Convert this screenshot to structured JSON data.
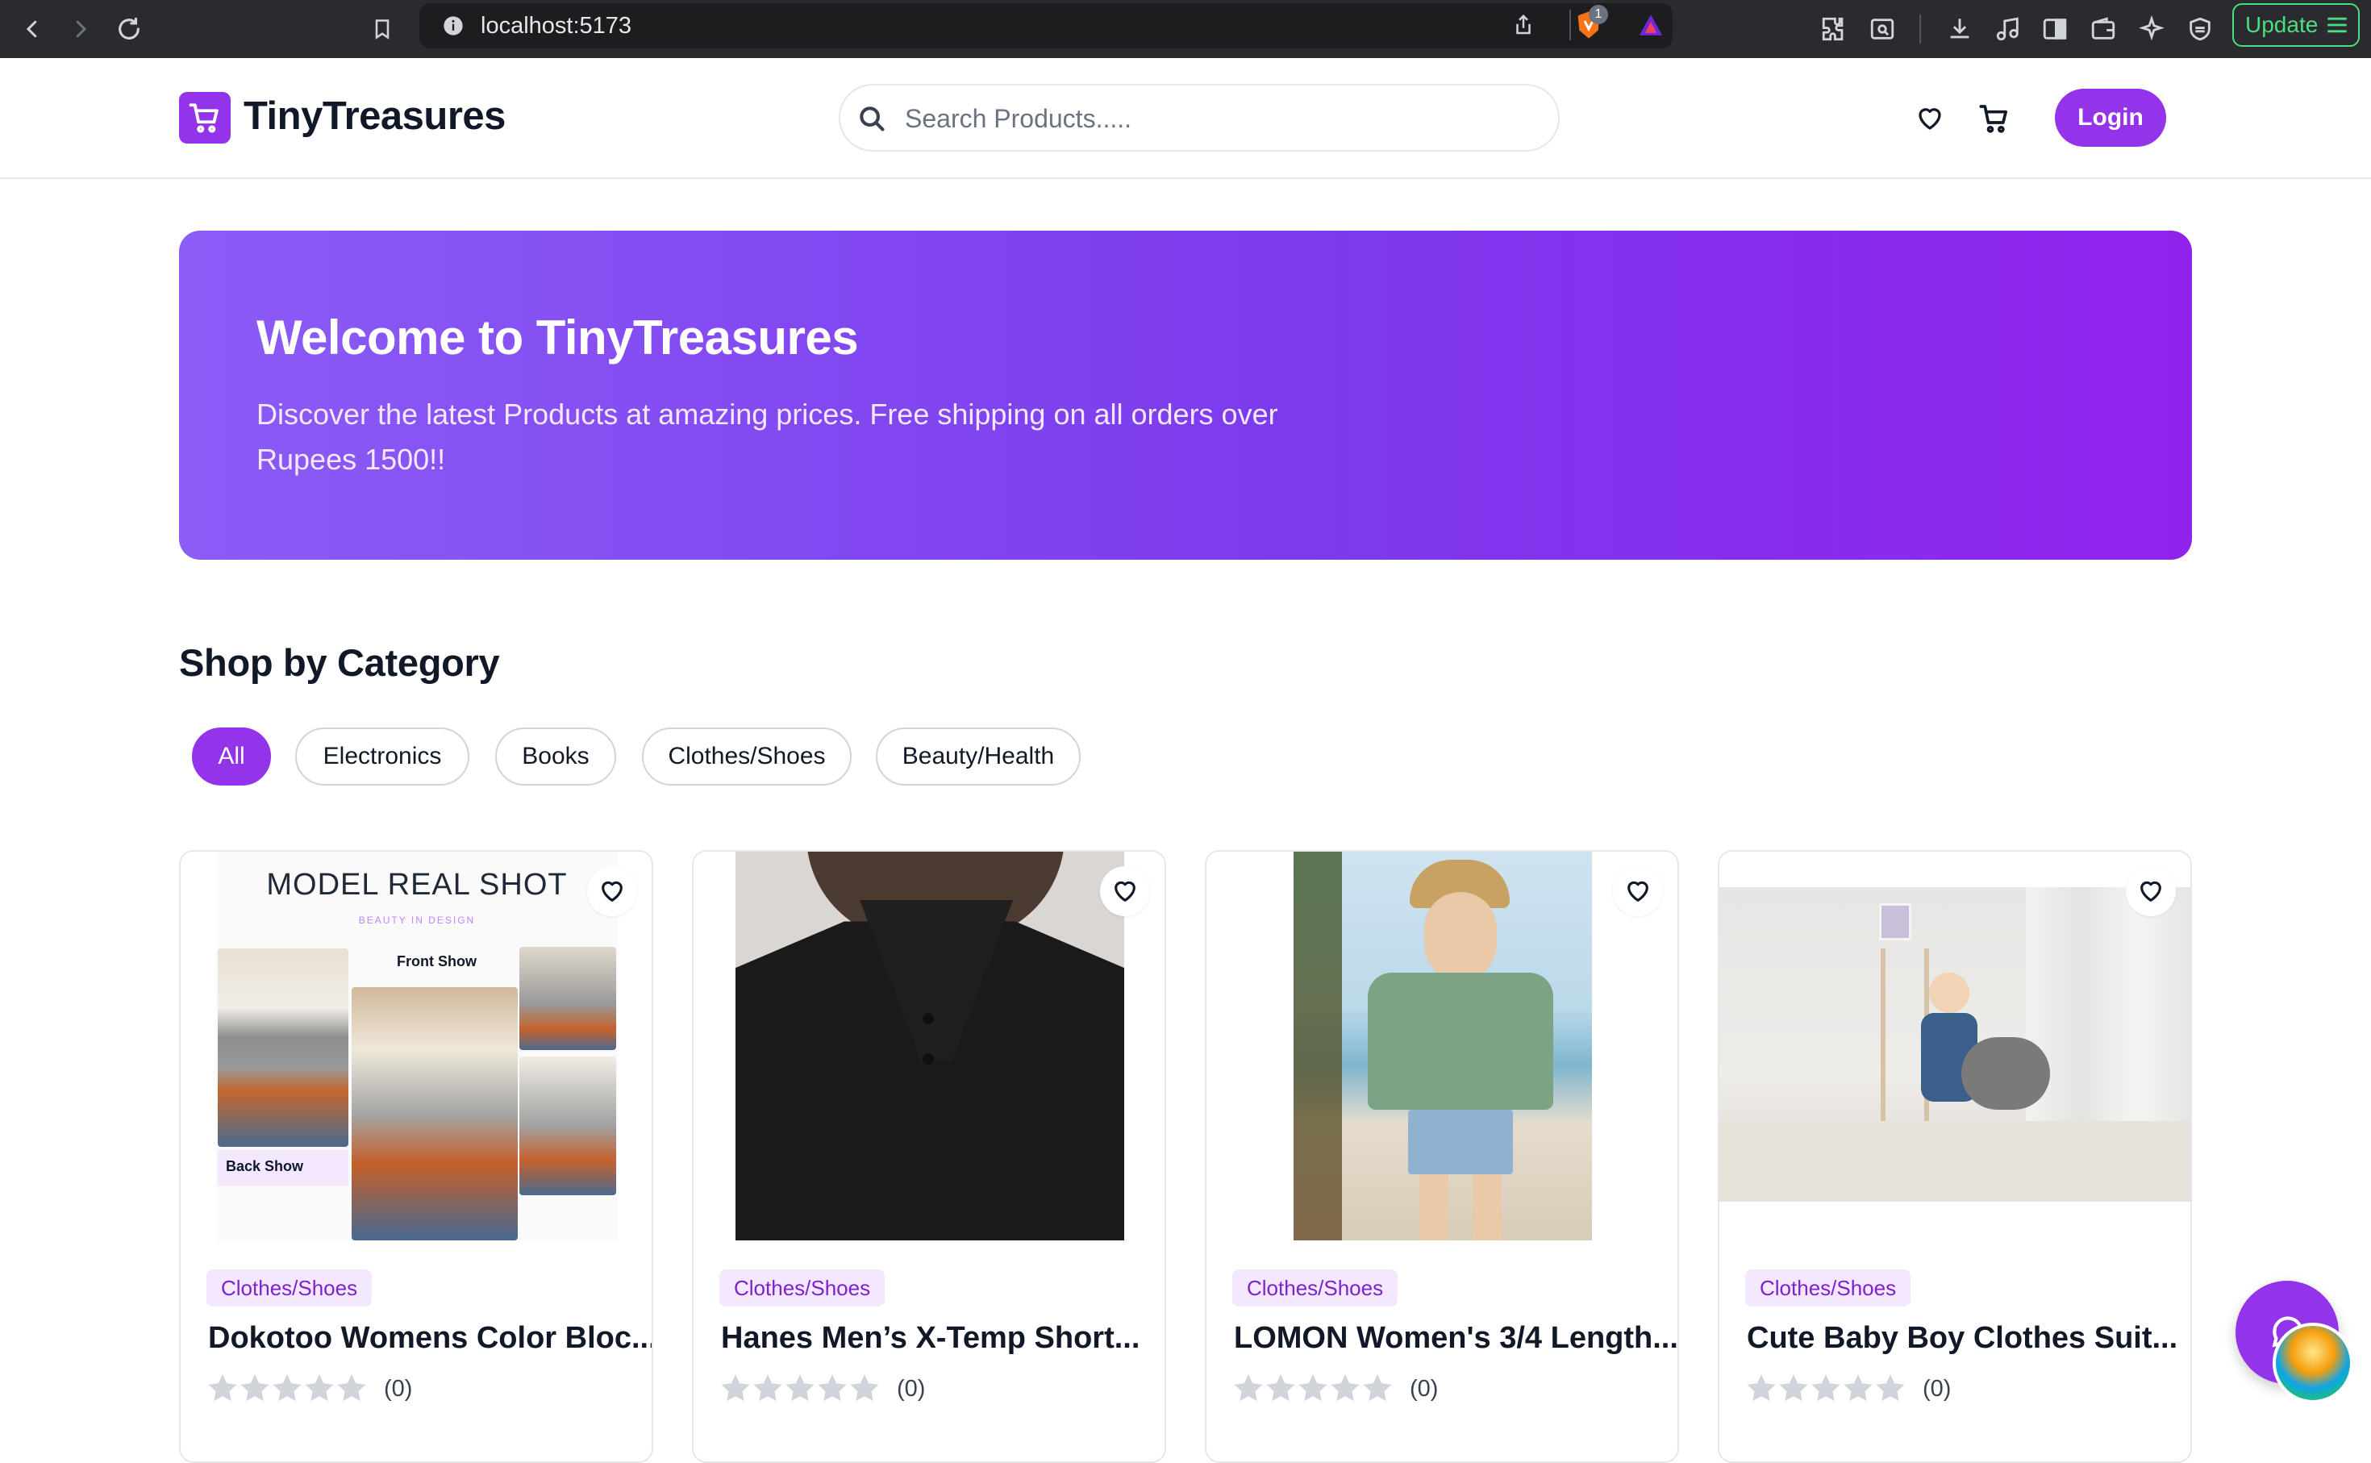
{
  "browser": {
    "url": "localhost:5173",
    "update_label": "Update",
    "brave_badge": "1"
  },
  "header": {
    "logo_text": "TinyTreasures",
    "search_placeholder": "Search Products.....",
    "login_label": "Login"
  },
  "hero": {
    "title": "Welcome to TinyTreasures",
    "subtitle": "Discover the latest Products at amazing prices. Free shipping on all orders over Rupees 1500!!"
  },
  "category": {
    "heading": "Shop by Category",
    "chips": [
      "All",
      "Electronics",
      "Books",
      "Clothes/Shoes",
      "Beauty/Health"
    ],
    "active": "All"
  },
  "products": [
    {
      "category": "Clothes/Shoes",
      "title": "Dokotoo Womens Color Bloc...",
      "rating_count": "(0)",
      "stars": 0,
      "image_banner": "MODEL REAL SHOT",
      "image_sub": "BEAUTY IN DESIGN",
      "image_front": "Front Show",
      "image_back": "Back Show"
    },
    {
      "category": "Clothes/Shoes",
      "title": "Hanes Men’s X-Temp Short...",
      "rating_count": "(0)",
      "stars": 0
    },
    {
      "category": "Clothes/Shoes",
      "title": "LOMON Women's 3/4 Length...",
      "rating_count": "(0)",
      "stars": 0
    },
    {
      "category": "Clothes/Shoes",
      "title": "Cute Baby Boy Clothes Suit...",
      "rating_count": "(0)",
      "stars": 0
    }
  ],
  "colors": {
    "accent": "#9333ea",
    "badge_bg": "#f3e8ff",
    "badge_text": "#7e22ce",
    "hero_start": "#8b5cf6",
    "hero_end": "#9122ec"
  }
}
